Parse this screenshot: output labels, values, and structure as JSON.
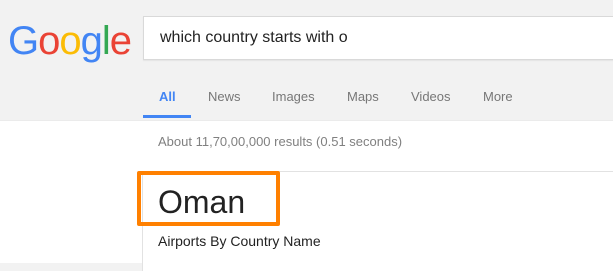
{
  "logo": {
    "letters": [
      "G",
      "o",
      "o",
      "g",
      "l",
      "e"
    ],
    "colors": [
      "#4285f4",
      "#ea4335",
      "#fbbc05",
      "#4285f4",
      "#34a853",
      "#ea4335"
    ]
  },
  "search": {
    "query": "which country starts with o"
  },
  "tabs": [
    {
      "label": "All",
      "active": true
    },
    {
      "label": "News",
      "active": false
    },
    {
      "label": "Images",
      "active": false
    },
    {
      "label": "Maps",
      "active": false
    },
    {
      "label": "Videos",
      "active": false
    },
    {
      "label": "More",
      "active": false
    }
  ],
  "results": {
    "stats": "About 11,70,00,000 results (0.51 seconds)"
  },
  "answer_card": {
    "answer": "Oman",
    "subtitle": "Airports By Country Name",
    "highlight_color": "#ff8000"
  },
  "colors": {
    "accent": "#4285f4"
  }
}
